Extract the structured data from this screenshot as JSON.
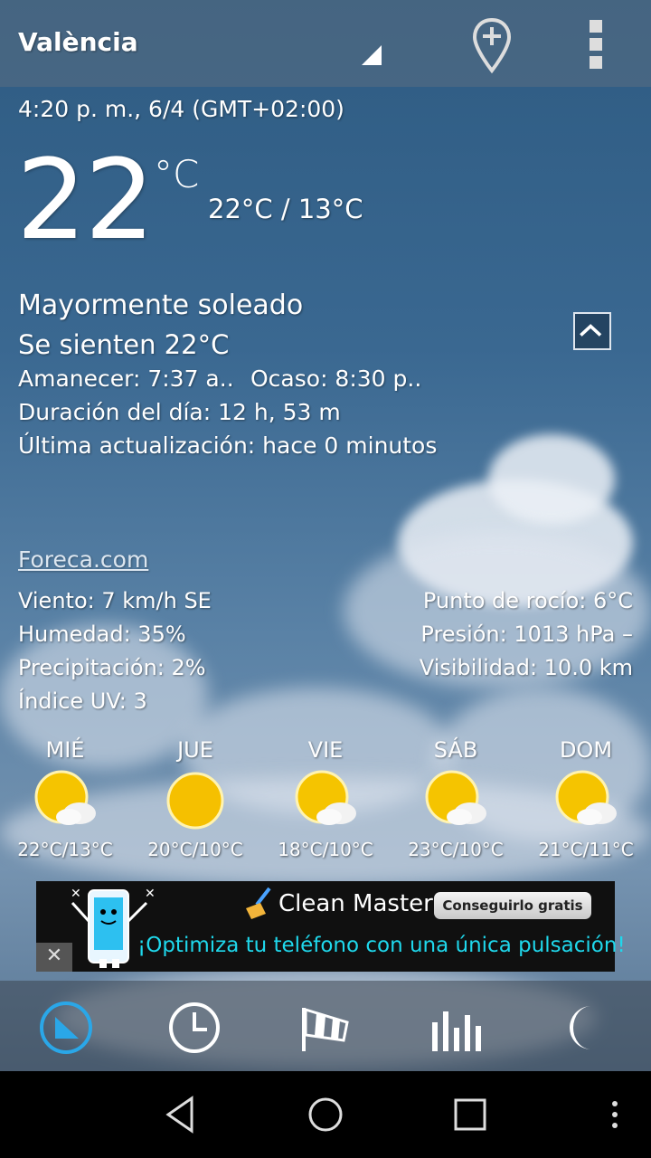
{
  "header": {
    "city": "València"
  },
  "current": {
    "time": "4:20 p. m., 6/4 (GMT+02:00)",
    "temperature": "22",
    "unit": "°C",
    "range": "22°C / 13°C",
    "condition": "Mayormente soleado",
    "feels_like": "Se sienten 22°C",
    "sunrise": "Amanecer:  7:37 a..",
    "sunset": "Ocaso:  8:30 p..",
    "day_length": "Duración del día: 12 h, 53 m",
    "last_update": "Última actualización: hace 0 minutos"
  },
  "source_link": "Foreca.com",
  "details_left": [
    "Viento:  7 km/h SE",
    "Humedad:  35%",
    "Precipitación:  2%",
    "Índice UV:  3"
  ],
  "details_right": [
    "Punto de rocío:  6°C",
    "Presión:  1013 hPa –",
    "Visibilidad:  10.0 km"
  ],
  "forecast": [
    {
      "day": "MIÉ",
      "range": "22°C/13°C",
      "icon": "sun-cloud-icon"
    },
    {
      "day": "JUE",
      "range": "20°C/10°C",
      "icon": "sun-icon"
    },
    {
      "day": "VIE",
      "range": "18°C/10°C",
      "icon": "sun-cloud-icon"
    },
    {
      "day": "SÁB",
      "range": "23°C/10°C",
      "icon": "sun-cloud-icon"
    },
    {
      "day": "DOM",
      "range": "21°C/11°C",
      "icon": "sun-cloud-icon"
    }
  ],
  "ad": {
    "title": "Clean Master",
    "button": "Conseguirlo gratis",
    "subtitle": "¡Optimiza tu teléfono con una única pulsación!",
    "close": "✕"
  },
  "tabs": [
    "current-weather-icon",
    "clock-icon",
    "windsock-icon",
    "bar-chart-icon",
    "moon-icon"
  ],
  "colors": {
    "accent_blue": "#2aa7e8",
    "ad_text": "#1fd8ec"
  }
}
